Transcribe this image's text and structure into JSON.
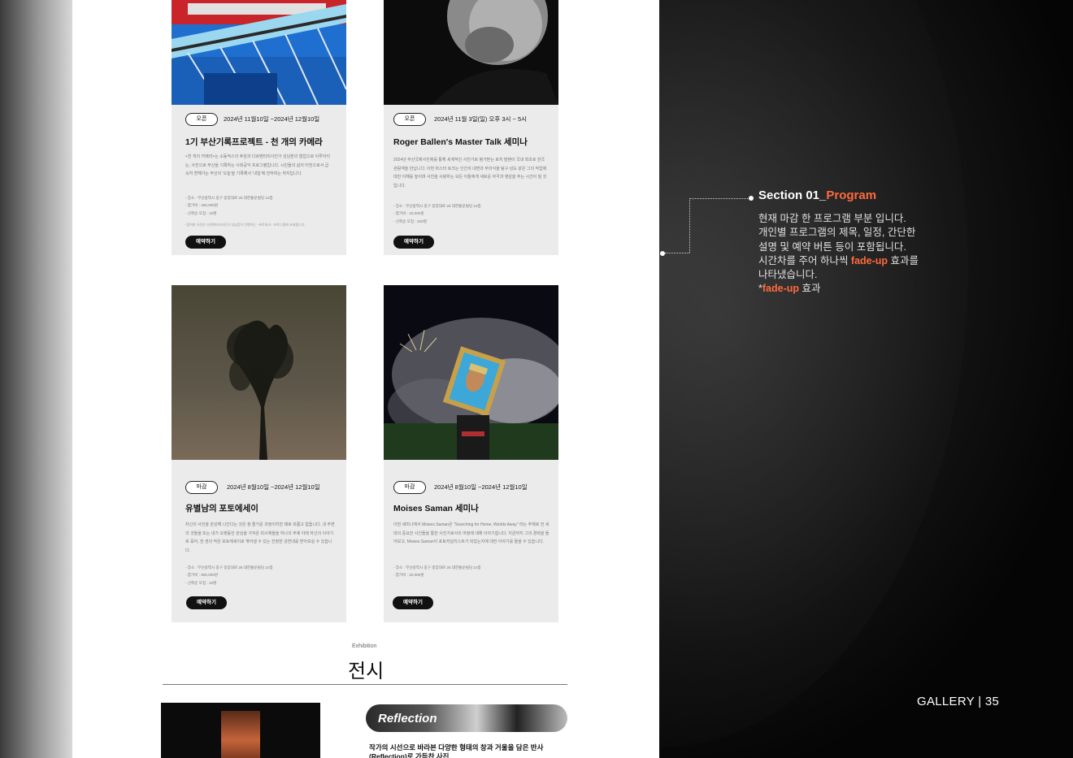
{
  "cards": [
    {
      "status": "오픈",
      "date": "2024년 11월10일 ~2024년 12월10일",
      "title": "1기 부산기록프로젝트 - 천 개의 카메라",
      "desc": "<천 개의 카메라>는 소동적스의 후원과 다큐멘터리사진가 성남훈의 협업으로 이루어지는, 사진으로 부산을 기록하는 사회공익 프로그램입니다. 시민들의 삶의 터전으로서 급속히 변해가는 부산의 '오늘'을 기록해서 '내일'에 전하려는 취지입니다.",
      "meta": [
        "- 장소 : 부산광역시 중구 중앙대로 26 대한통운빌딩 10층",
        "- 참가비 : 250,000원",
        "- 선착순 모집 : 10명"
      ],
      "note": "*참여한 사진은 다큐멘터리사진가 성남훈이 진행하는 ~포토워크~ 프로그램에 초대됩니다.",
      "button": "예약하기"
    },
    {
      "status": "오픈",
      "date": "2024년 11월 3일(일) 오후 3시 ~ 5시",
      "title": "Roger Ballen's Master Talk 세미나",
      "desc": "2024년 부산국제사진제를 통해 세계적인 사진가로 평가받는 로저 발렌이 국내 최초로 한국 관람객을 만납니다. 이번 마스터 토크는 인간의 내면과 무의식을 탐구 삼도 같은 그의 작업에 대한 이해를 높이며 사진을 사랑하는 모든 이들에게 새로운 자극과 영감을 주는 시간이 될 것입니다.",
      "meta": [
        "- 장소 : 부산광역시 중구 중앙대로 26 대한통운빌딩 10층",
        "- 참가비 : 10,000원",
        "- 선착순 모집 : 200명"
      ],
      "note": "",
      "button": "예약하기"
    },
    {
      "status": "마감",
      "date": "2024년 8월10일 ~2024년 12월10일",
      "title": "유별남의 포토에세이",
      "desc": "자신의 사진을 완성해 나간다는 것은 참 즐거운 과정이지만 때로 외롭고 힘듭니다. 내 주변의 것들을 또는 내가 오랫동안 관심을 가져온 피사체들을 하나의 주제 아래 자신의 이야기로 묶어, 한 권의 작은 포토에세이로 엮어낼 수 있는 진정한 강연내를 받아보실 수 있습니다.",
      "meta": [
        "- 장소 : 부산광역시 중구 중앙대로 26 대한통운빌딩 10층",
        "- 참가비 : 600,000원",
        "- 선착순 모집 : 10명"
      ],
      "note": "",
      "button": "예약하기"
    },
    {
      "status": "마감",
      "date": "2024년 8월10일 ~2024년 12월10일",
      "title": "Moises Saman 세미나",
      "desc": "이번 세미나에서 Moises Saman은 \"Searching for Home, Worlds Away\" 라는 주제로 전 세대의 중요한 사건들을 통한 사진가로서의 여정에 대해 이야기합니다. 지금까지 그의 경력을 돌아보고, Moises Saman이 포토저널리스트가 되었는지에 대한 이야기를 들을 수 있습니다.",
      "meta": [
        "- 장소 : 부산광역시 중구 중앙대로 26 대한통운빌딩 10층",
        "- 참가비 : 20,000원"
      ],
      "note": "",
      "button": "예약하기"
    }
  ],
  "exhibition": {
    "small_label": "Exhibition",
    "title": "전시",
    "reflection_label": "Reflection",
    "reflection_text": "작가의 시선으로 바라본 다양한 형태의 창과 거울을 담은 반사(Reflection)로 가득찬 사진"
  },
  "annotation": {
    "title_prefix": "Section 01_",
    "title_accent": "Program",
    "line1": "현재 마감 한 프로그램 부분 입니다.",
    "line2": "개인별 프로그램의 제목, 일정, 간단한",
    "line3": "설명 및 예약 버튼 등이 포함됩니다.",
    "line4_pre": "시간차를 주어 하나씩 ",
    "line4_accent": "fade-up",
    "line4_post": " 효과를",
    "line5": "나타냈습니다.",
    "line6_pre": "*",
    "line6_accent": "fade-up",
    "line6_post": " 효과"
  },
  "footer": {
    "section": "GALLERY",
    "separator": "|",
    "page_number": "35"
  },
  "colors": {
    "accent": "#ff6a3d",
    "card_bg": "#ebebeb",
    "button_bg": "#111111"
  }
}
